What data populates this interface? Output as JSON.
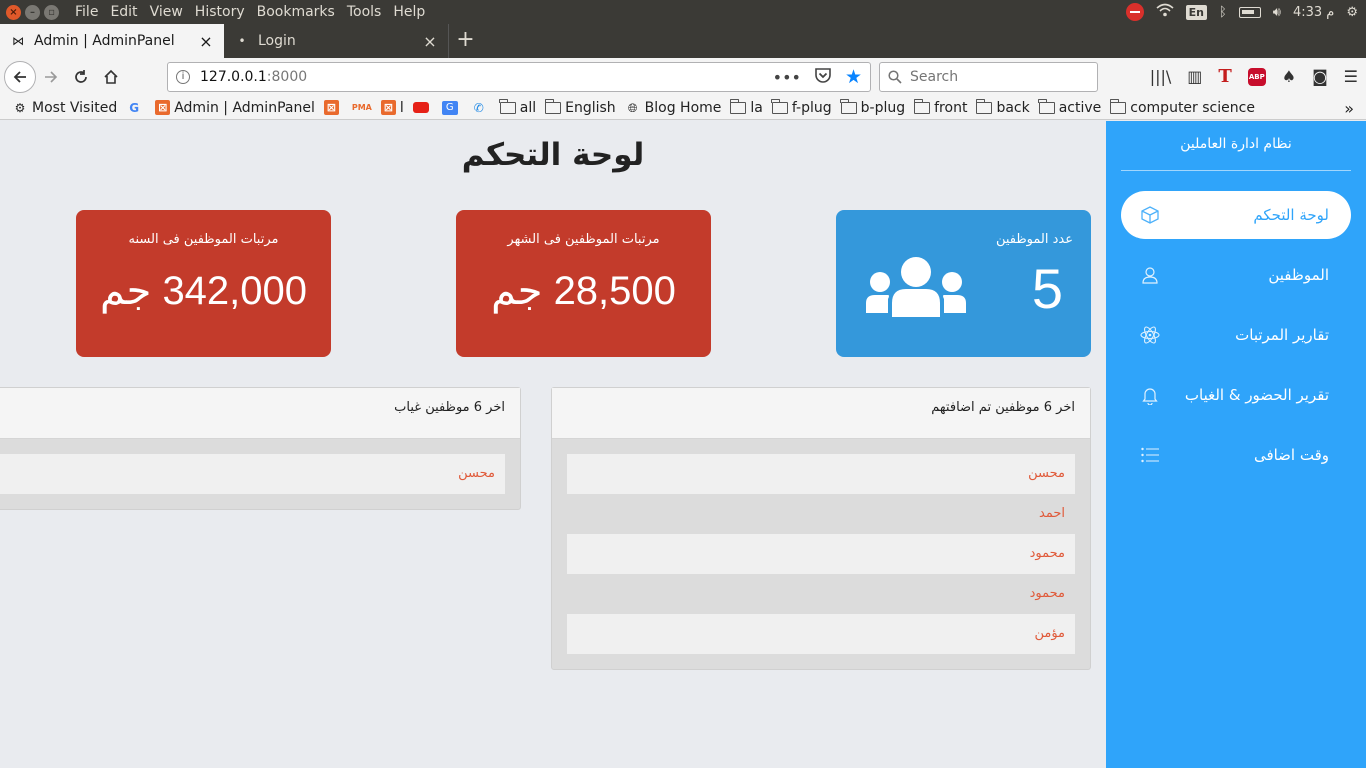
{
  "os": {
    "menu": [
      "File",
      "Edit",
      "View",
      "History",
      "Bookmarks",
      "Tools",
      "Help"
    ],
    "keyboard_layout": "En",
    "clock": "4:33 م"
  },
  "tabs": [
    {
      "title": "Admin | AdminPanel",
      "icon": "bowtie-icon",
      "active": true
    },
    {
      "title": "Login",
      "icon": "dot-icon",
      "active": false
    }
  ],
  "nav": {
    "url_host": "127.0.0.1",
    "url_port": ":8000",
    "search_placeholder": "Search"
  },
  "bookmarks": [
    {
      "label": "Most Visited",
      "icon": "gear-icon"
    },
    {
      "label": "",
      "icon": "google-icon"
    },
    {
      "label": "Admin | AdminPanel",
      "icon": "xampp-icon"
    },
    {
      "label": "",
      "icon": "xampp-icon"
    },
    {
      "label": "",
      "icon": "pma-icon"
    },
    {
      "label": "l",
      "icon": "xampp-icon"
    },
    {
      "label": "",
      "icon": "youtube-icon"
    },
    {
      "label": "",
      "icon": "translate-icon"
    },
    {
      "label": "",
      "icon": "phone-icon"
    },
    {
      "label": "all",
      "icon": "folder-icon"
    },
    {
      "label": "English",
      "icon": "folder-icon"
    },
    {
      "label": "Blog Home",
      "icon": "globe-icon"
    },
    {
      "label": "la",
      "icon": "folder-icon"
    },
    {
      "label": "f-plug",
      "icon": "folder-icon"
    },
    {
      "label": "b-plug",
      "icon": "folder-icon"
    },
    {
      "label": "front",
      "icon": "folder-icon"
    },
    {
      "label": "back",
      "icon": "folder-icon"
    },
    {
      "label": "active",
      "icon": "folder-icon"
    },
    {
      "label": "computer science",
      "icon": "folder-icon"
    }
  ],
  "page": {
    "title": "لوحة التحكم",
    "cards": [
      {
        "label": "عدد الموظفين",
        "value": "5",
        "color": "#3498db",
        "icon": "users-icon"
      },
      {
        "label": "مرتبات الموظفين فى الشهر",
        "value": "28,500 جم",
        "color": "#c33b2b"
      },
      {
        "label": "مرتبات الموظفين فى السنه",
        "value": "342,000 جم",
        "color": "#c33b2b"
      }
    ],
    "recent_added": {
      "title": "اخر 6 موظفين تم اضافتهم",
      "items": [
        "محسن",
        "احمد",
        "محمود",
        "محمود",
        "مؤمن"
      ]
    },
    "recent_absent": {
      "title": "اخر 6 موظفين غياب",
      "items": [
        "محسن"
      ]
    }
  },
  "sidebar": {
    "brand": "نظام ادارة العاملين",
    "color": "#2fa4fa",
    "items": [
      {
        "label": "لوحة التحكم",
        "icon": "cube-icon",
        "active": true
      },
      {
        "label": "الموظفين",
        "icon": "user-icon",
        "active": false
      },
      {
        "label": "تقارير المرتبات",
        "icon": "atom-icon",
        "active": false
      },
      {
        "label": "تقرير الحضور & الغياب",
        "icon": "bell-icon",
        "active": false
      },
      {
        "label": "وقت اضافى",
        "icon": "list-icon",
        "active": false
      }
    ]
  }
}
